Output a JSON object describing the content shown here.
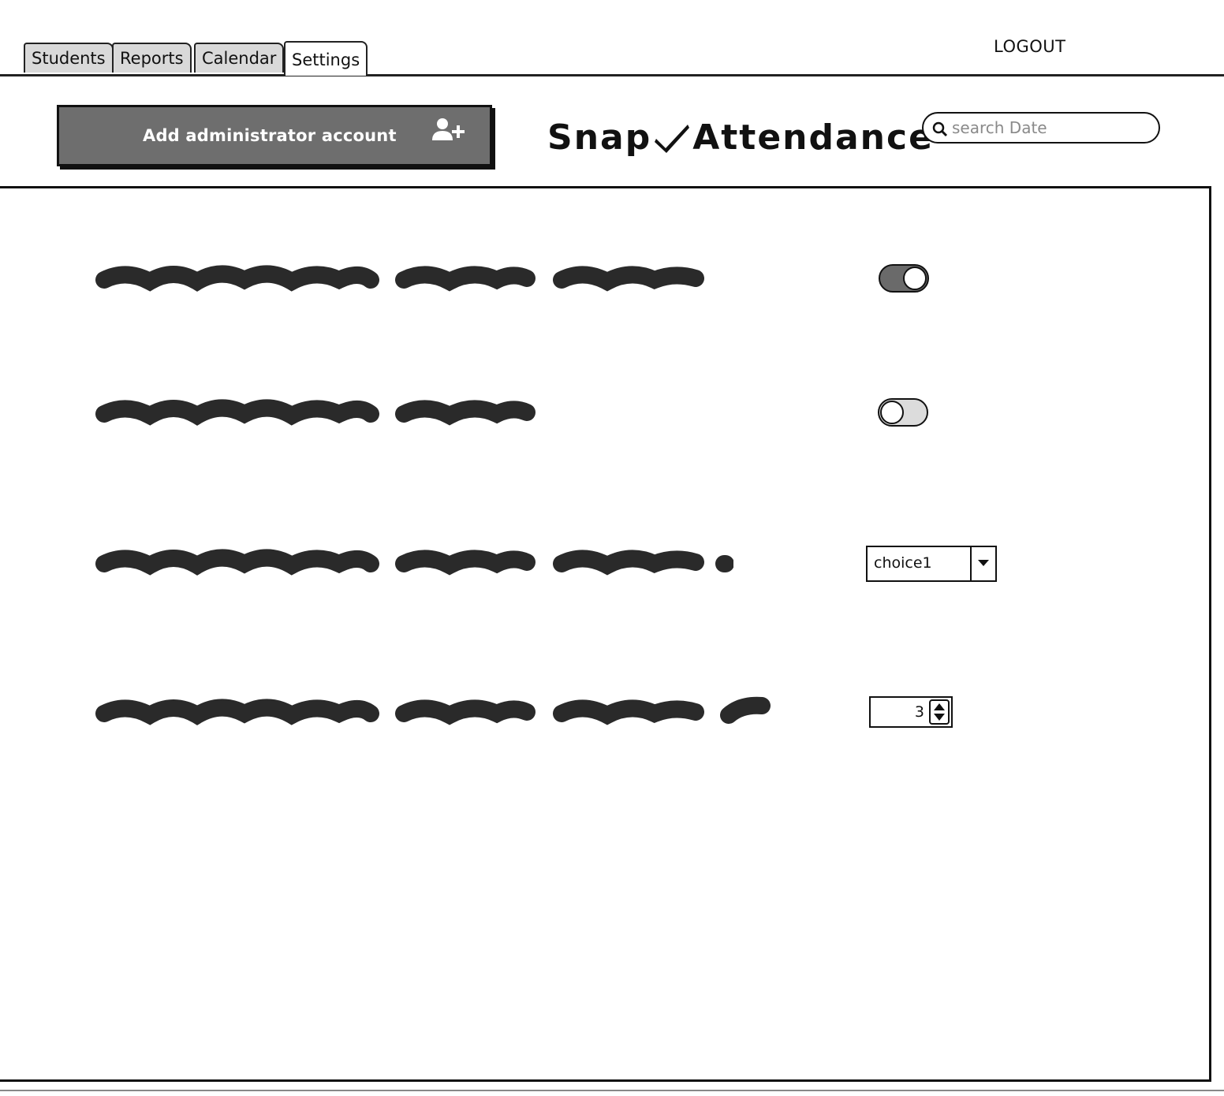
{
  "tabs": [
    {
      "label": "Students",
      "active": false
    },
    {
      "label": "Reports",
      "active": false
    },
    {
      "label": "Calendar",
      "active": false
    },
    {
      "label": "Settings",
      "active": true
    }
  ],
  "header": {
    "logout_label": "LOGOUT"
  },
  "toolbar": {
    "add_admin_label": "Add administrator account",
    "add_admin_icon": "add-user-icon"
  },
  "brand": {
    "name_left": "Snap",
    "name_right": "Attendance",
    "icon": "checkmark-icon"
  },
  "search": {
    "placeholder": "search Date",
    "value": ""
  },
  "settings": [
    {
      "control": "toggle",
      "state": "on"
    },
    {
      "control": "toggle",
      "state": "off"
    },
    {
      "control": "select",
      "value": "choice1"
    },
    {
      "control": "stepper",
      "value": "3"
    }
  ],
  "colors": {
    "button_fill": "#6e6e6e",
    "toggle_on": "#6a6a6a",
    "toggle_off": "#dcdcdc",
    "line": "#111111"
  }
}
